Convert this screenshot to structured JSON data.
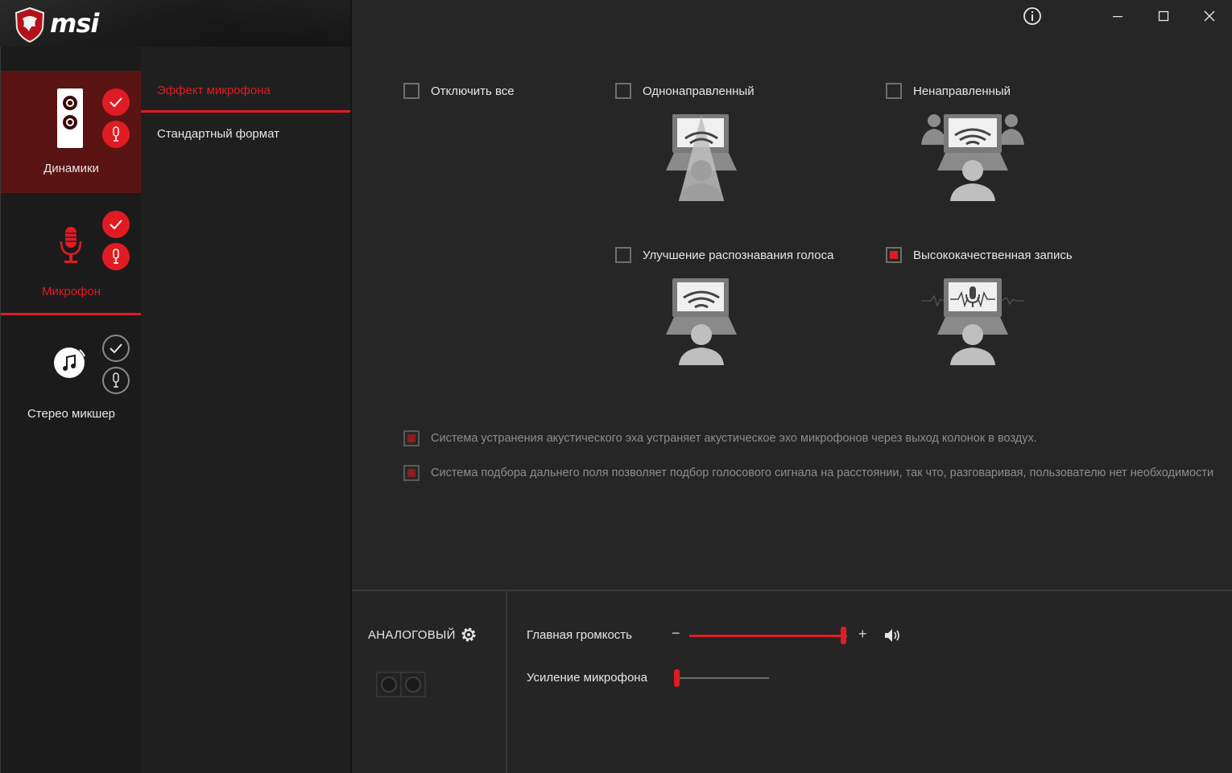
{
  "app": {
    "brand": "msi",
    "accent_color": "#e01b24",
    "window_controls": [
      "info-icon",
      "minimize-icon",
      "maximize-icon",
      "close-icon"
    ]
  },
  "devices": [
    {
      "label": "Динамики",
      "icon": "speaker-icon",
      "selected": true
    },
    {
      "label": "Микрофон",
      "icon": "microphone-icon",
      "selected": false
    },
    {
      "label": "Стерео микшер",
      "icon": "music-note-icon",
      "selected": false
    }
  ],
  "submenu": {
    "items": [
      {
        "label": "Эффект микрофона",
        "active": true
      },
      {
        "label": "Стандартный формат",
        "active": false
      }
    ]
  },
  "effects": {
    "disable_all": {
      "label": "Отключить все",
      "checked": false
    },
    "unidirectional": {
      "label": "Однонаправленный",
      "checked": false
    },
    "omnidirectional": {
      "label": "Ненаправленный",
      "checked": false
    },
    "voice_recognition": {
      "label": "Улучшение распознавания голоса",
      "checked": false
    },
    "hq_recording": {
      "label": "Высококачественная запись",
      "checked": true
    }
  },
  "notes": [
    {
      "text": "Система устранения акустического эха устраняет акустическое эхо микрофонов через выход колонок в воздух.",
      "checked": true
    },
    {
      "text": "Система подбора дальнего поля позволяет подбор голосового сигнала на расстоянии, так что, разговаривая, пользователю нет необходимости",
      "checked": true
    }
  ],
  "bottom": {
    "analog_label": "АНАЛОГОВЫЙ",
    "main_volume_label": "Главная громкость",
    "main_volume_value": 1.0,
    "minus": "−",
    "plus": "+",
    "mic_boost_label": "Усиление микрофона",
    "mic_boost_value": 0.0
  }
}
